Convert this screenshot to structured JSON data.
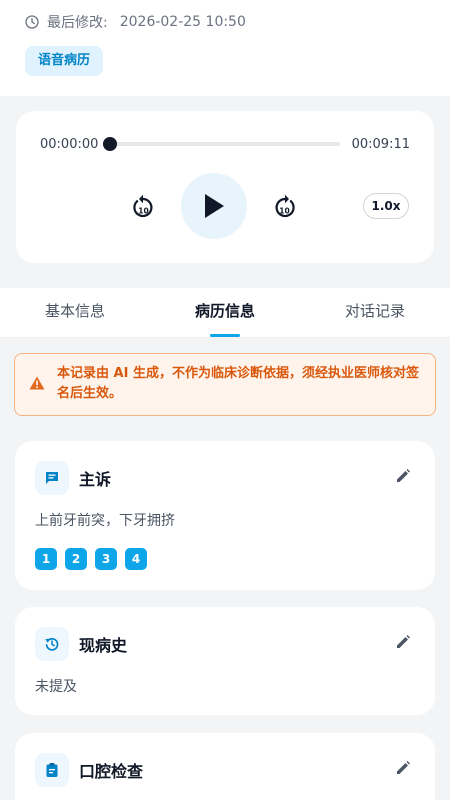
{
  "header": {
    "modified_label": "最后修改:",
    "modified_value": "2026-02-25 10:50",
    "tag": "语音病历"
  },
  "player": {
    "current_time": "00:00:00",
    "total_time": "00:09:11",
    "progress_percent": 0,
    "speed": "1.0x",
    "skip_seconds": "10"
  },
  "tabs": [
    {
      "label": "基本信息",
      "active": false
    },
    {
      "label": "病历信息",
      "active": true
    },
    {
      "label": "对话记录",
      "active": false
    }
  ],
  "notice": {
    "text": "本记录由 AI 生成，不作为临床诊断依据，须经执业医师核对签名后生效。"
  },
  "sections": [
    {
      "title": "主诉",
      "icon": "chat-icon",
      "content": "上前牙前突，下牙拥挤",
      "refs": [
        "1",
        "2",
        "3",
        "4"
      ]
    },
    {
      "title": "现病史",
      "icon": "history-icon",
      "content": "未提及"
    },
    {
      "title": "口腔检查",
      "icon": "clipboard-icon"
    }
  ],
  "colors": {
    "accent": "#0ea5e9",
    "warning": "#d9580d",
    "background": "#f3f4f6"
  }
}
